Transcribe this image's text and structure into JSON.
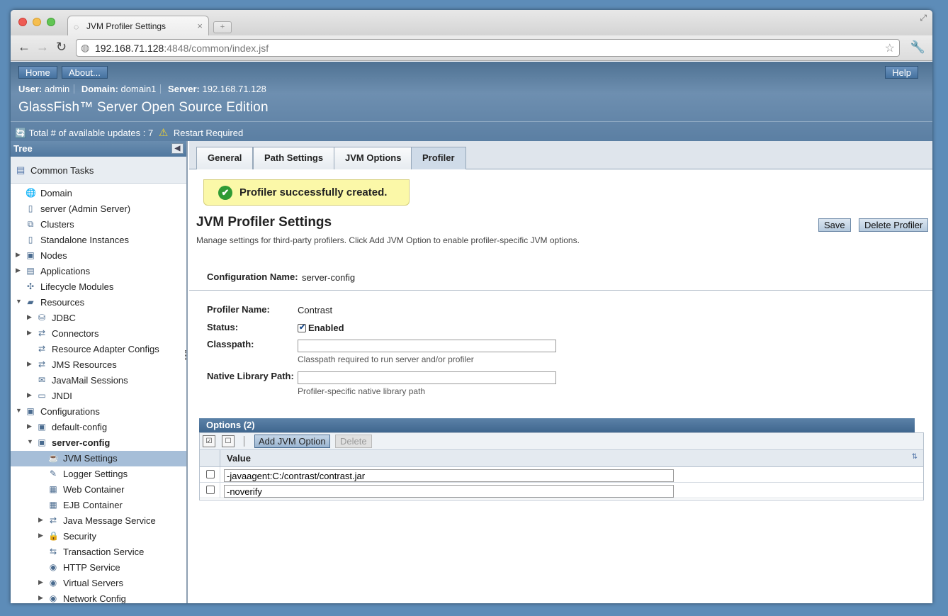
{
  "browser": {
    "tab_title": "JVM Profiler Settings",
    "url_host": "192.168.71.128",
    "url_rest": ":4848/common/index.jsf"
  },
  "header": {
    "home_label": "Home",
    "about_label": "About...",
    "help_label": "Help",
    "user_label": "User:",
    "user_value": "admin",
    "domain_label": "Domain:",
    "domain_value": "domain1",
    "server_label": "Server:",
    "server_value": "192.168.71.128",
    "product_title": "GlassFish™ Server Open Source Edition",
    "updates_text": "Total # of available updates : 7",
    "restart_text": "Restart Required"
  },
  "tree": {
    "title": "Tree",
    "common_tasks": "Common Tasks",
    "items": [
      {
        "label": "Domain",
        "level": 0,
        "arrow": "",
        "icon": "🌐"
      },
      {
        "label": "server (Admin Server)",
        "level": 0,
        "arrow": "",
        "icon": "▯"
      },
      {
        "label": "Clusters",
        "level": 0,
        "arrow": "",
        "icon": "⧉"
      },
      {
        "label": "Standalone Instances",
        "level": 0,
        "arrow": "",
        "icon": "▯"
      },
      {
        "label": "Nodes",
        "level": 0,
        "arrow": "▶",
        "icon": "▣"
      },
      {
        "label": "Applications",
        "level": 0,
        "arrow": "▶",
        "icon": "▤"
      },
      {
        "label": "Lifecycle Modules",
        "level": 0,
        "arrow": "",
        "icon": "✣"
      },
      {
        "label": "Resources",
        "level": 0,
        "arrow": "▼",
        "icon": "▰"
      },
      {
        "label": "JDBC",
        "level": 1,
        "arrow": "▶",
        "icon": "⛁"
      },
      {
        "label": "Connectors",
        "level": 1,
        "arrow": "▶",
        "icon": "⇄"
      },
      {
        "label": "Resource Adapter Configs",
        "level": 1,
        "arrow": "",
        "icon": "⇄"
      },
      {
        "label": "JMS Resources",
        "level": 1,
        "arrow": "▶",
        "icon": "⇄"
      },
      {
        "label": "JavaMail Sessions",
        "level": 1,
        "arrow": "",
        "icon": "✉"
      },
      {
        "label": "JNDI",
        "level": 1,
        "arrow": "▶",
        "icon": "▭"
      },
      {
        "label": "Configurations",
        "level": 0,
        "arrow": "▼",
        "icon": "▣"
      },
      {
        "label": "default-config",
        "level": 1,
        "arrow": "▶",
        "icon": "▣"
      },
      {
        "label": "server-config",
        "level": 1,
        "arrow": "▼",
        "icon": "▣",
        "bold": true
      },
      {
        "label": "JVM Settings",
        "level": 2,
        "arrow": "",
        "icon": "☕",
        "selected": true
      },
      {
        "label": "Logger Settings",
        "level": 2,
        "arrow": "",
        "icon": "✎"
      },
      {
        "label": "Web Container",
        "level": 2,
        "arrow": "",
        "icon": "▦"
      },
      {
        "label": "EJB Container",
        "level": 2,
        "arrow": "",
        "icon": "▦"
      },
      {
        "label": "Java Message Service",
        "level": 2,
        "arrow": "▶",
        "icon": "⇄"
      },
      {
        "label": "Security",
        "level": 2,
        "arrow": "▶",
        "icon": "🔒"
      },
      {
        "label": "Transaction Service",
        "level": 2,
        "arrow": "",
        "icon": "⇆"
      },
      {
        "label": "HTTP Service",
        "level": 2,
        "arrow": "",
        "icon": "◉"
      },
      {
        "label": "Virtual Servers",
        "level": 2,
        "arrow": "▶",
        "icon": "◉"
      },
      {
        "label": "Network Config",
        "level": 2,
        "arrow": "▶",
        "icon": "◉"
      }
    ]
  },
  "tabs": [
    "General",
    "Path Settings",
    "JVM Options",
    "Profiler"
  ],
  "active_tab": "Profiler",
  "alert": "Profiler successfully created.",
  "page": {
    "title": "JVM Profiler Settings",
    "description": "Manage settings for third-party profilers. Click Add JVM Option to enable profiler-specific JVM options.",
    "save_label": "Save",
    "delete_profiler_label": "Delete Profiler",
    "config_name_label": "Configuration Name:",
    "config_name_value": "server-config",
    "profiler_name_label": "Profiler Name:",
    "profiler_name_value": "Contrast",
    "status_label": "Status:",
    "status_checkbox_label": "Enabled",
    "status_enabled": true,
    "classpath_label": "Classpath:",
    "classpath_value": "",
    "classpath_help": "Classpath required to run server and/or profiler",
    "native_label": "Native Library Path:",
    "native_value": "",
    "native_help": "Profiler-specific native library path"
  },
  "options": {
    "title": "Options (2)",
    "add_label": "Add JVM Option",
    "delete_label": "Delete",
    "column_value": "Value",
    "rows": [
      "-javaagent:C:/contrast/contrast.jar",
      "-noverify"
    ]
  }
}
